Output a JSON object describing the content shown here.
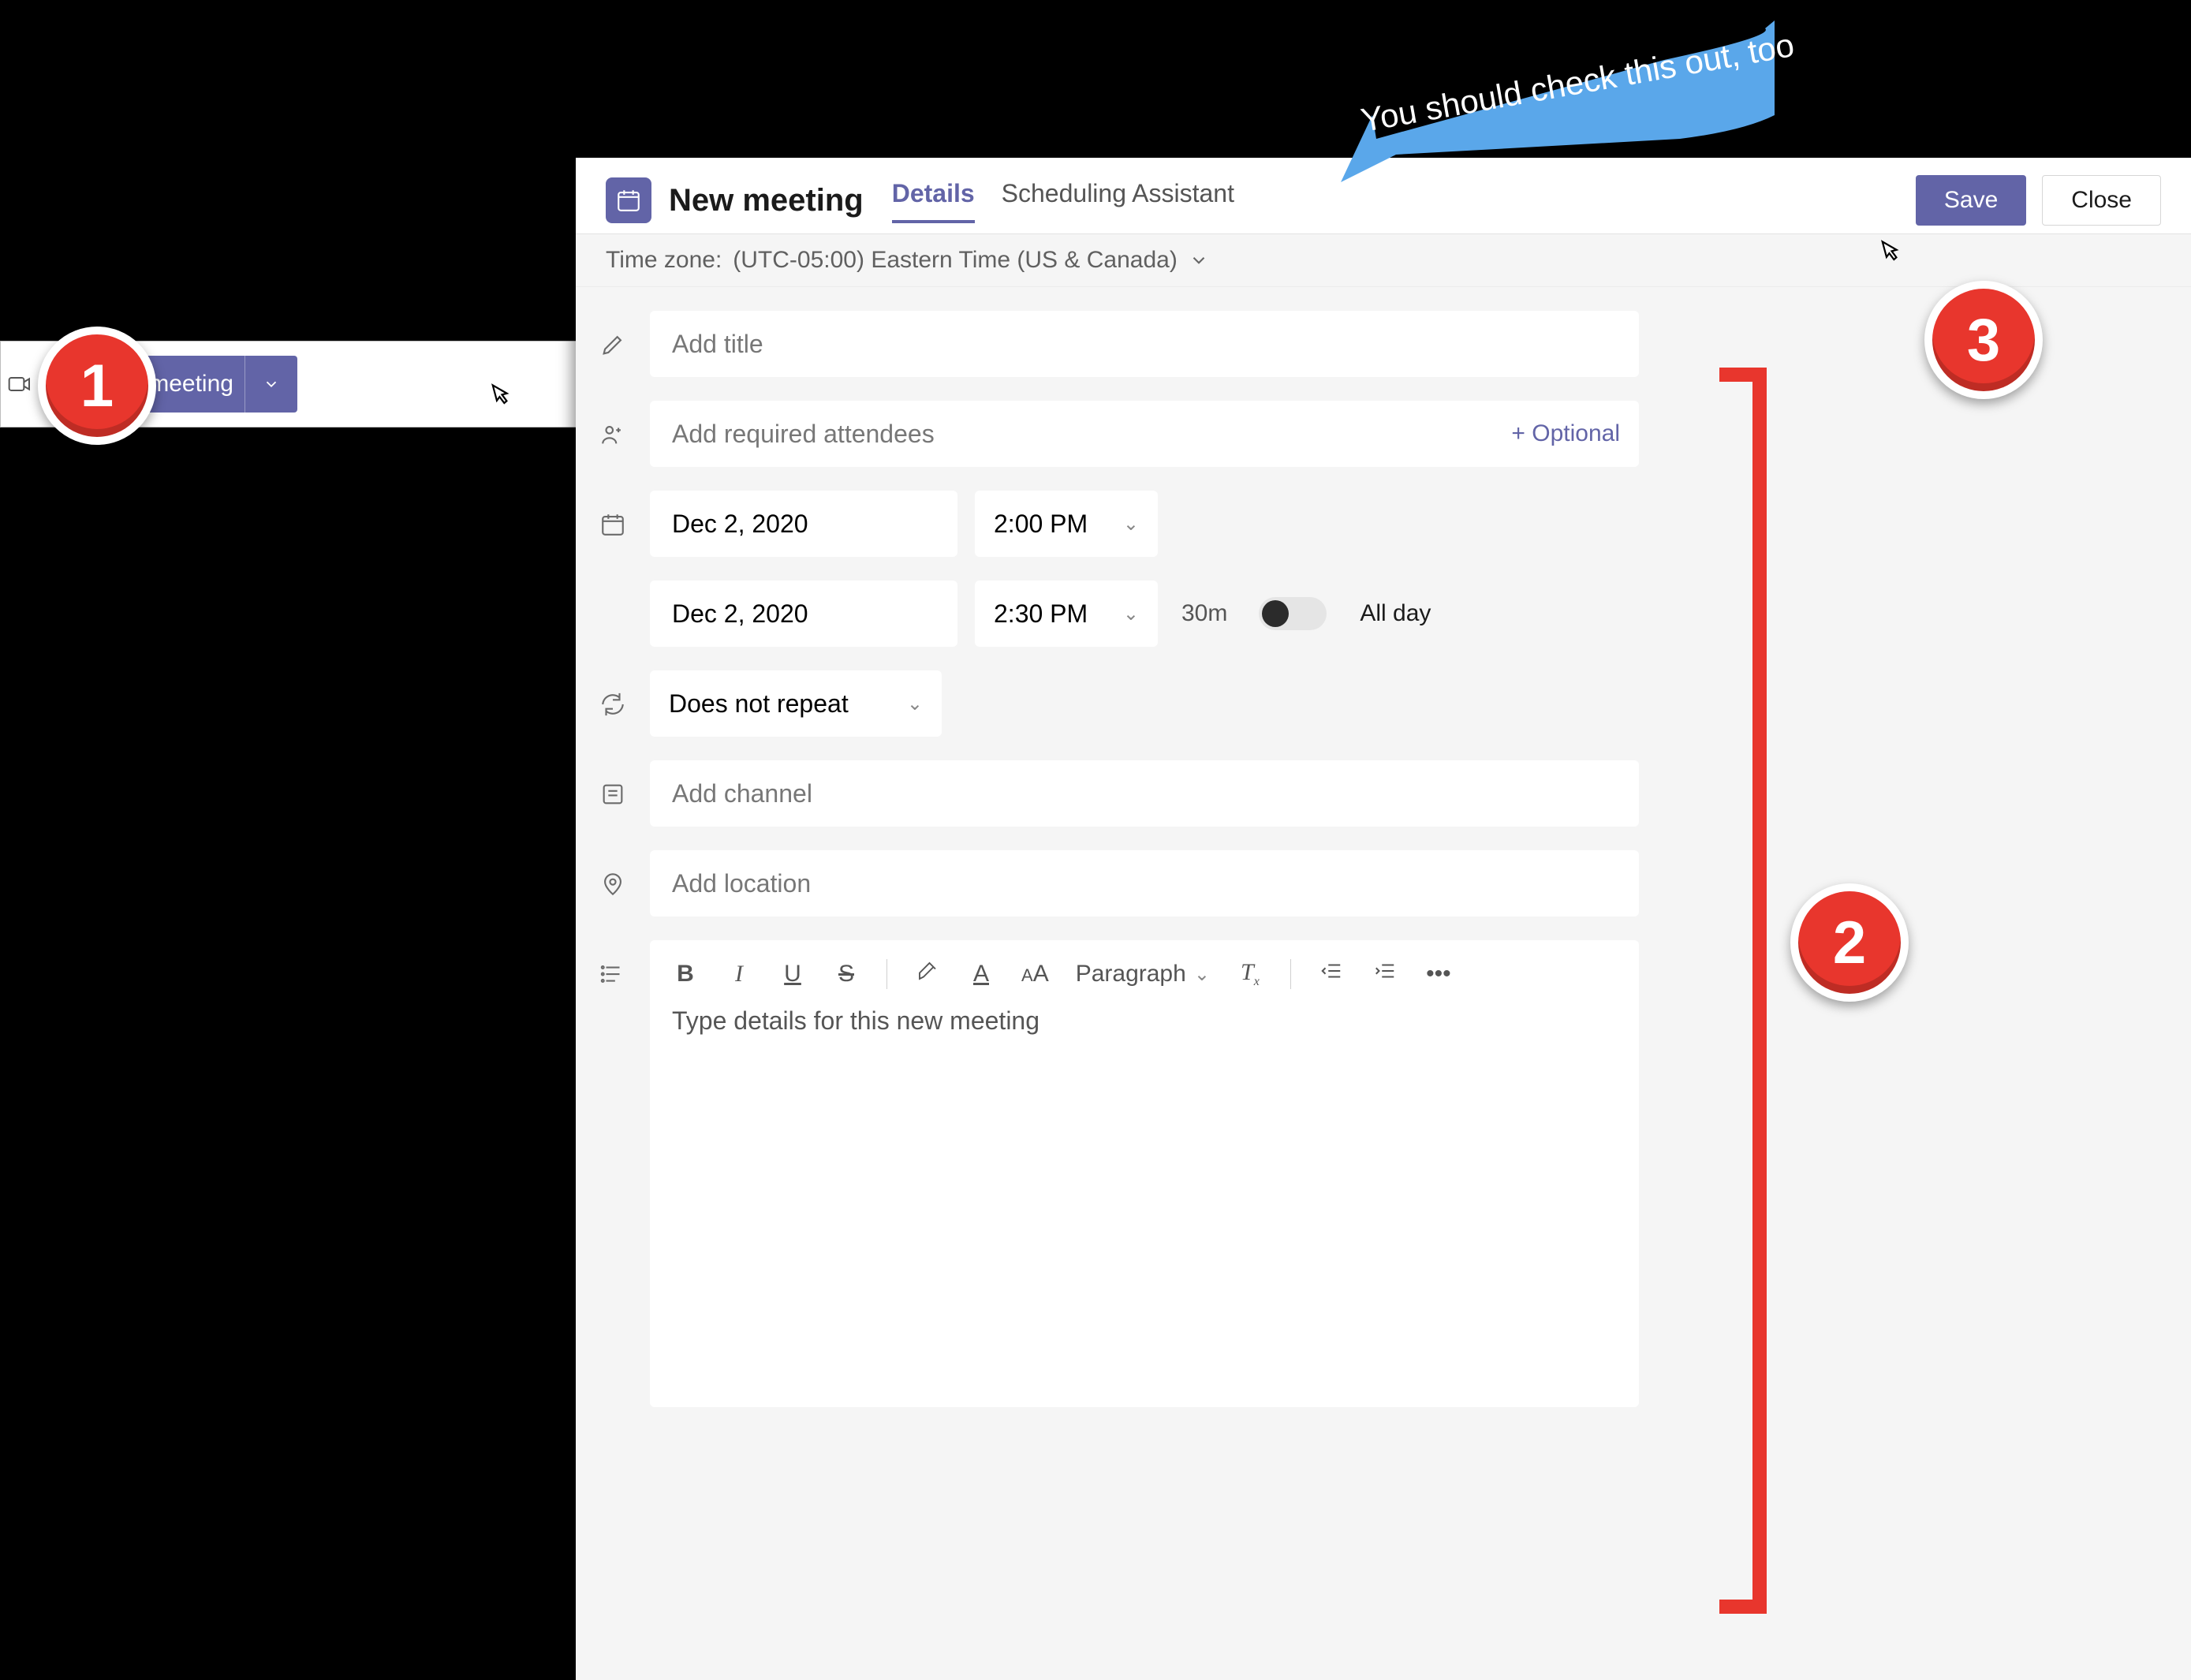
{
  "step1": {
    "button_label": "New meeting"
  },
  "callout": {
    "text": "You should check this out, too"
  },
  "header": {
    "title": "New meeting",
    "tabs": [
      "Details",
      "Scheduling Assistant"
    ],
    "active_tab_index": 0,
    "save_label": "Save",
    "close_label": "Close"
  },
  "timezone": {
    "label": "Time zone:",
    "value": "(UTC-05:00) Eastern Time (US & Canada)"
  },
  "form": {
    "title_placeholder": "Add title",
    "attendees_placeholder": "Add required attendees",
    "optional_link": "+ Optional",
    "start_date": "Dec 2, 2020",
    "start_time": "2:00 PM",
    "end_date": "Dec 2, 2020",
    "end_time": "2:30 PM",
    "duration": "30m",
    "all_day_label": "All day",
    "all_day_on": false,
    "recurrence": "Does not repeat",
    "channel_placeholder": "Add channel",
    "location_placeholder": "Add location",
    "editor_paragraph_label": "Paragraph",
    "editor_placeholder": "Type details for this new meeting"
  },
  "badges": {
    "one": "1",
    "two": "2",
    "three": "3"
  }
}
